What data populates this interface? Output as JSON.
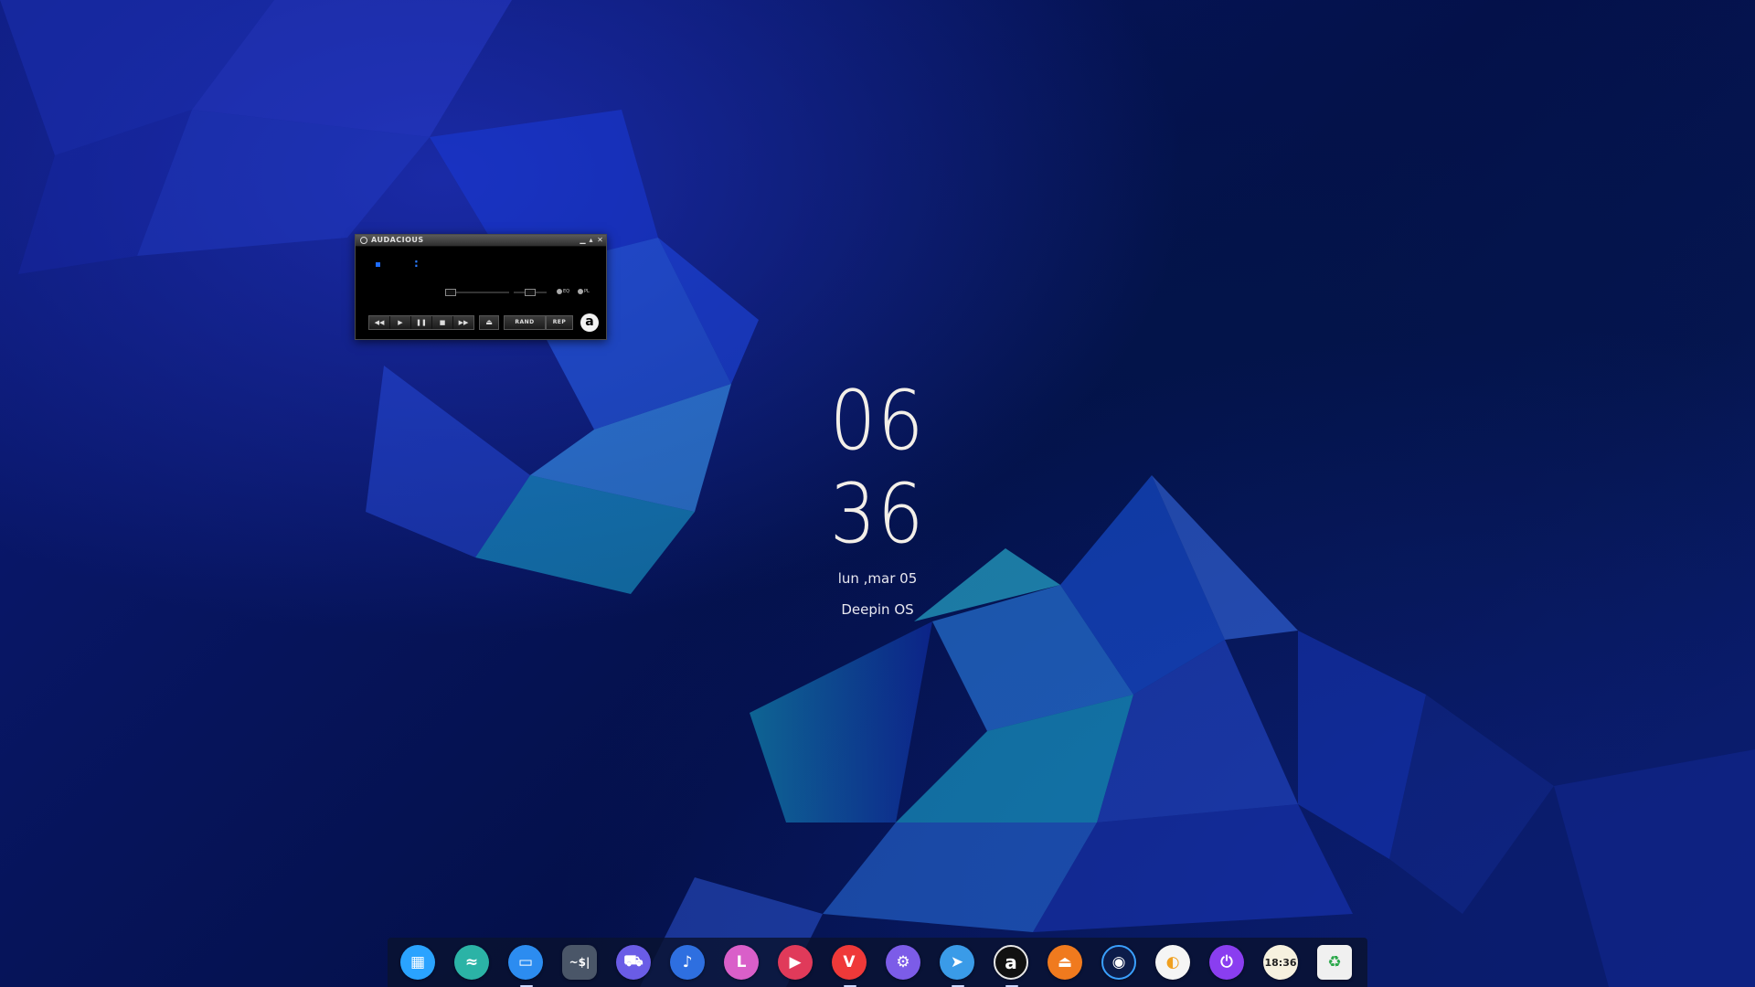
{
  "clock": {
    "hours": "06",
    "minutes": "36",
    "date": "lun ,mar 05",
    "os_name": "Deepin OS"
  },
  "audacious": {
    "title": "AUDACIOUS",
    "time_colon": ":",
    "toggles": {
      "eq": "EQ",
      "pl": "PL"
    },
    "controls": {
      "prev": "◀◀",
      "play": "▶",
      "pause": "❚❚",
      "stop": "■",
      "next": "▶▶",
      "eject": "⏏"
    },
    "rand_label": "RAND",
    "rep_label": "REP",
    "logo_letter": "a"
  },
  "dock": {
    "items": [
      {
        "name": "launcher",
        "glyph": "▦",
        "color": "#2aa3ff"
      },
      {
        "name": "multitasking",
        "glyph": "≈",
        "color": "#2bb3a6"
      },
      {
        "name": "file-manager",
        "glyph": "▭",
        "color": "#2c8cf0"
      },
      {
        "name": "terminal",
        "glyph": "~$|",
        "color": "#4a5668"
      },
      {
        "name": "app-store",
        "glyph": "⛟",
        "color": "#6a5ce6"
      },
      {
        "name": "music",
        "glyph": "♪",
        "color": "#2e6fe0"
      },
      {
        "name": "libreoffice",
        "glyph": "L",
        "color": "#d95fc9"
      },
      {
        "name": "video-player",
        "glyph": "▶",
        "color": "#e03a5a"
      },
      {
        "name": "vivaldi",
        "glyph": "V",
        "color": "#ef3939"
      },
      {
        "name": "settings",
        "glyph": "⚙",
        "color": "#7c5ce8"
      },
      {
        "name": "telegram",
        "glyph": "➤",
        "color": "#3a9be8"
      },
      {
        "name": "audacious",
        "glyph": "a",
        "color": "#111111"
      },
      {
        "name": "vlc-eject",
        "glyph": "⏏",
        "color": "#f07a1e"
      },
      {
        "name": "system-monitor",
        "glyph": "◉",
        "color": "#0c1c4a"
      },
      {
        "name": "weather",
        "glyph": "◐",
        "color": "#f5f5f5"
      },
      {
        "name": "power",
        "glyph": "⏻",
        "color": "#8a3ef0"
      },
      {
        "name": "clock",
        "glyph": "18:36",
        "color": "#f6f1df"
      },
      {
        "name": "trash",
        "glyph": "♻",
        "color": "#f0f0f0"
      }
    ]
  }
}
